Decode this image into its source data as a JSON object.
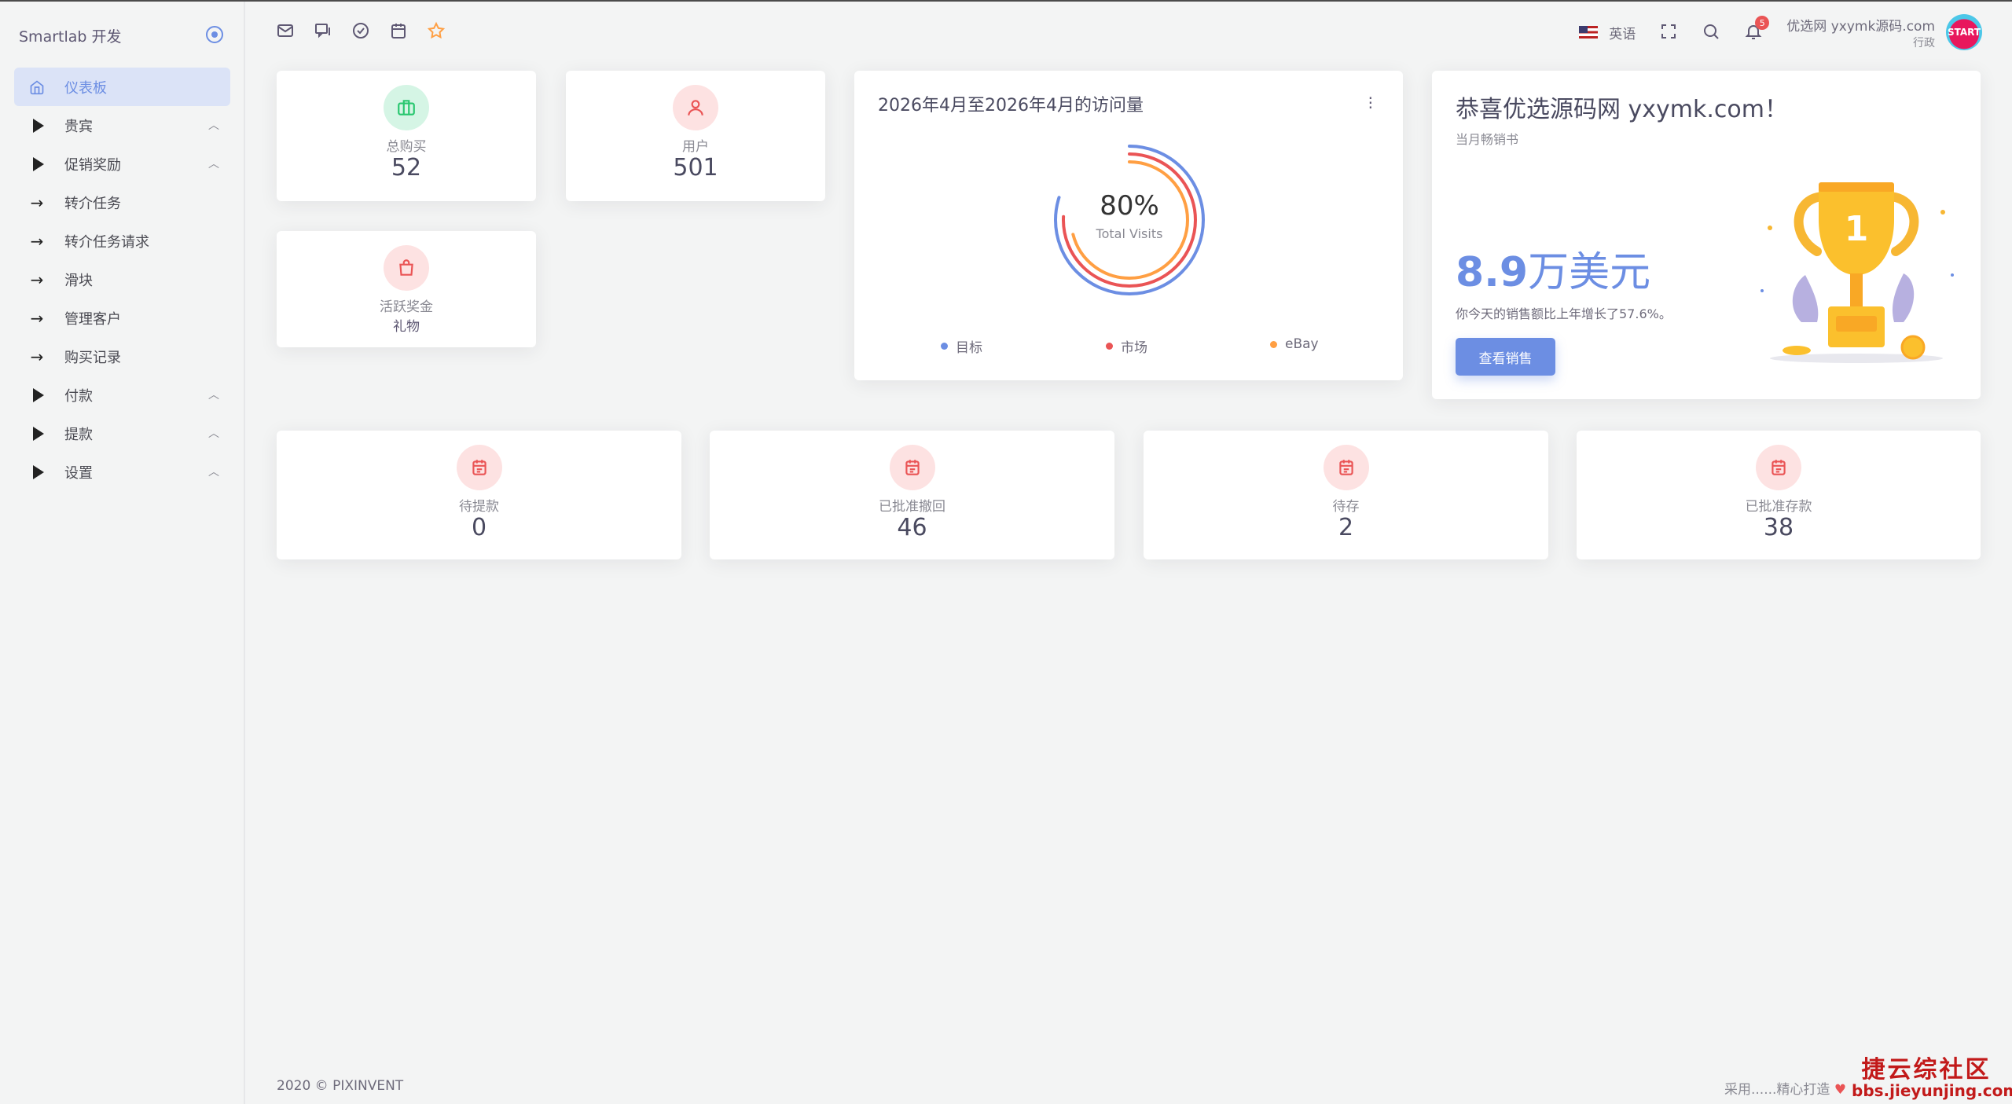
{
  "brand": {
    "name": "Smartlab 开发"
  },
  "sidebar": {
    "items": [
      {
        "label": "仪表板",
        "icon": "home-icon",
        "active": true
      },
      {
        "label": "贵宾",
        "icon": "play-triangle-icon",
        "chevron": "chevron-up-icon"
      },
      {
        "label": "促销奖励",
        "icon": "play-triangle-icon",
        "chevron": "chevron-up-icon"
      },
      {
        "label": "转介任务",
        "icon": "arrow-right-icon"
      },
      {
        "label": "转介任务请求",
        "icon": "arrow-right-icon"
      },
      {
        "label": "滑块",
        "icon": "arrow-right-icon"
      },
      {
        "label": "管理客户",
        "icon": "arrow-right-icon"
      },
      {
        "label": "购买记录",
        "icon": "arrow-right-icon"
      },
      {
        "label": "付款",
        "icon": "play-triangle-icon",
        "chevron": "chevron-up-icon"
      },
      {
        "label": "提款",
        "icon": "play-triangle-icon",
        "chevron": "chevron-up-icon"
      },
      {
        "label": "设置",
        "icon": "play-triangle-icon",
        "chevron": "chevron-up-icon"
      }
    ]
  },
  "topbar": {
    "icons": [
      "mail-icon",
      "chat-icon",
      "check-circle-icon",
      "calendar-icon",
      "star-icon"
    ],
    "language": "英语",
    "notifications_count": "5",
    "user_name": "优选网 yxymk源码.com",
    "user_role": "行政",
    "avatar_text": "START"
  },
  "stats": {
    "total_purchase": {
      "label": "总购买",
      "value": "52"
    },
    "users": {
      "label": "用户",
      "value": "501"
    },
    "active_bonus": {
      "label": "活跃奖金",
      "value": "礼物"
    }
  },
  "visits": {
    "title": "2026年4月至2026年4月的访问量",
    "percent": "80%",
    "subtitle": "Total Visits",
    "legend": [
      {
        "label": "目标",
        "color": "#6c8ee3"
      },
      {
        "label": "市场",
        "color": "#ea5455"
      },
      {
        "label": "eBay",
        "color": "#ff9f43"
      }
    ]
  },
  "congrats": {
    "title": "恭喜优选源码网 yxymk.com！",
    "subtitle": "当月畅销书",
    "amount_number": "8.9",
    "amount_unit": "万美元",
    "description": "你今天的销售额比上年增长了57.6%。",
    "button": "查看销售"
  },
  "bottom_stats": [
    {
      "label": "待提款",
      "value": "0"
    },
    {
      "label": "已批准撤回",
      "value": "46"
    },
    {
      "label": "待存",
      "value": "2"
    },
    {
      "label": "已批准存款",
      "value": "38"
    }
  ],
  "footer": {
    "copyright": "2020 © PIXINVENT",
    "right_text": "采用......精心打造"
  },
  "watermark": {
    "line1": "捷云综社区",
    "line2": "bbs.jieyunjing.com"
  },
  "colors": {
    "primary": "#6c8ee3",
    "danger": "#ea5455",
    "warning": "#ff9f43",
    "success": "#28c76f"
  }
}
